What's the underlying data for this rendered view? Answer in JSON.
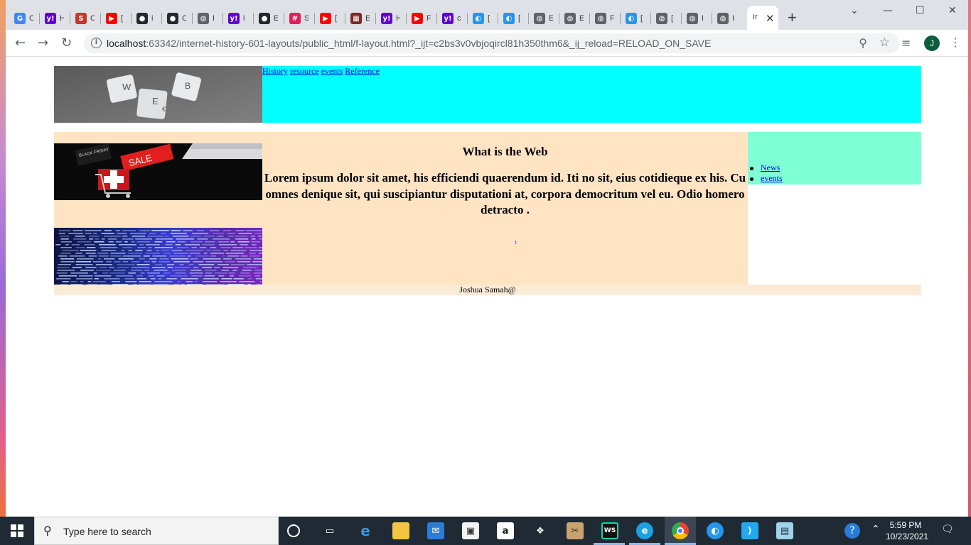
{
  "browser": {
    "tabs": [
      {
        "icon": "google-icon",
        "label": "G",
        "color": "#4285f4"
      },
      {
        "icon": "yahoo-icon",
        "label": "y!",
        "color": "#6001d2"
      },
      {
        "icon": "strike-icon",
        "label": "S",
        "color": "#c0392b"
      },
      {
        "icon": "youtube-icon",
        "label": "▶",
        "color": "#ff0000"
      },
      {
        "icon": "github-icon",
        "label": "●",
        "color": "#24292e"
      },
      {
        "icon": "github-icon",
        "label": "●",
        "color": "#24292e"
      },
      {
        "icon": "globe-icon",
        "label": "◍",
        "color": "#5f6368"
      },
      {
        "icon": "yahoo-icon",
        "label": "y!",
        "color": "#6001d2"
      },
      {
        "icon": "github-icon",
        "label": "●",
        "color": "#24292e"
      },
      {
        "icon": "slack-icon",
        "label": "#",
        "color": "#e01e5a"
      },
      {
        "icon": "youtube-icon",
        "label": "▶",
        "color": "#ff0000"
      },
      {
        "icon": "grid-icon",
        "label": "▦",
        "color": "#7a2a2a"
      },
      {
        "icon": "yahoo-icon",
        "label": "y!",
        "color": "#6001d2"
      },
      {
        "icon": "youtube-icon",
        "label": "▶",
        "color": "#ff0000"
      },
      {
        "icon": "yahoo-icon",
        "label": "y!",
        "color": "#6001d2"
      },
      {
        "icon": "docker-icon",
        "label": "◐",
        "color": "#2496ed"
      },
      {
        "icon": "docker-icon",
        "label": "◐",
        "color": "#2496ed"
      },
      {
        "icon": "globe-icon",
        "label": "◍",
        "color": "#5f6368"
      },
      {
        "icon": "globe-icon",
        "label": "◍",
        "color": "#5f6368"
      },
      {
        "icon": "globe-icon",
        "label": "◍",
        "color": "#5f6368"
      },
      {
        "icon": "docker-icon",
        "label": "◐",
        "color": "#2496ed"
      },
      {
        "icon": "globe-icon",
        "label": "◍",
        "color": "#5f6368"
      },
      {
        "icon": "globe-icon",
        "label": "◍",
        "color": "#5f6368"
      },
      {
        "icon": "globe-icon",
        "label": "◍",
        "color": "#5f6368"
      }
    ],
    "tab_letters": [
      "C",
      "H",
      "C",
      "[",
      "i",
      "C",
      "I",
      "i",
      "E",
      "S",
      "[",
      "E",
      "H",
      "F",
      "c",
      "[",
      "[",
      "E",
      "E",
      "F",
      "[",
      "[",
      "I",
      "I"
    ],
    "active_tab_letter": "Ir",
    "new_tab": "+",
    "url_host": "localhost",
    "url_rest": ":63342/internet-history-601-layouts/public_html/f-layout.html?_ijt=c2bs3v0vbjoqircl81h350thm6&_ij_reload=RELOAD_ON_SAVE",
    "profile_initial": "J"
  },
  "page": {
    "nav": [
      "History",
      "resource",
      "events",
      "Reference"
    ],
    "heading": "What is the Web",
    "paragraph": "Lorem ipsum dolor sit amet, his efficiendi quaerendum id. Iti no sit, eius cotidieque ex his. Cu omnes denique sit, qui suscipiantur disputationi at, corpora democritum vel eu. Odio homero detracto .",
    "dot_link": ".",
    "aside_links": [
      "News",
      "events"
    ],
    "footer": "Joshua Samah@",
    "colors": {
      "header_nav_bg": "#00ffff",
      "content_bg": "#ffe4c4",
      "aside_bg": "#7fffd4",
      "footer_bg": "#faebd7",
      "link": "#0000ee"
    },
    "header_image_tiles": [
      "W",
      "B",
      "E",
      "€"
    ],
    "sale_image_text": [
      "SALE",
      "BLACK FRIDAY"
    ]
  },
  "taskbar": {
    "search_placeholder": "Type here to search",
    "time": "5:59 PM",
    "date": "10/23/2021",
    "apps": [
      "task-view-icon",
      "taskview-icon",
      "edge-legacy-icon",
      "file-explorer-icon",
      "mail-icon",
      "store-icon",
      "amazon-icon",
      "dropbox-icon",
      "snipping-icon",
      "webstorm-icon",
      "edge-icon",
      "chrome-icon",
      "docker-icon",
      "vscode-icon",
      "notepad-icon"
    ]
  }
}
